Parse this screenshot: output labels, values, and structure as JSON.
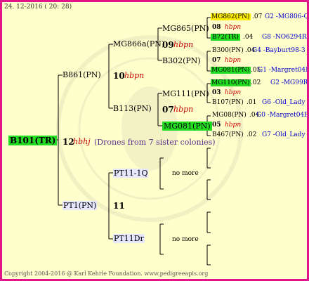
{
  "date": "24. 12-2016 ( 20: 28)",
  "root": {
    "label": "B101(TR)",
    "gen": "12",
    "hb": "hbhj",
    "note": "(Drones from 7 sister colonies)"
  },
  "dam": {
    "label": "B861(PN)",
    "gen": "10",
    "hb": "hbpn"
  },
  "sire": {
    "label": "PT1(PN)",
    "gen": "11"
  },
  "n_mg866a": {
    "label": "MG866a(PN)",
    "gen": "09",
    "hb": "hbpn"
  },
  "n_b113": {
    "label": "B113(PN)",
    "gen": "07",
    "hb": "hbpn"
  },
  "n_pt11q": {
    "label": "PT11-1Q"
  },
  "n_pt11dr": {
    "label": "PT11Dr"
  },
  "n_mg865": {
    "label": "MG865(PN)"
  },
  "n_b302": {
    "label": "B302(PN)"
  },
  "n_mg111": {
    "label": "MG111(PN)"
  },
  "n_mg081": {
    "label": "MG081(PN)"
  },
  "nomore1": "no more",
  "nomore2": "no more",
  "g1": {
    "label": "MG862(PN)",
    "gen": ".07",
    "line": "G2 -MG806-Q"
  },
  "g1b": {
    "gen": "08",
    "hb": "hbpn"
  },
  "g2": {
    "label": "B72(TR)",
    "gen": ".04",
    "line": "G8 -NO6294R"
  },
  "g3": {
    "label": "B300(PN)",
    "gen": ".04",
    "line": "G4 -Bayburt98-3"
  },
  "g3b": {
    "gen": "07",
    "hb": "hbpn"
  },
  "g4": {
    "label": "MG081(PN)",
    "gen": ".05",
    "line": "G1 -Margret04R"
  },
  "g5": {
    "label": "MG110(PN)",
    "gen": ".02",
    "line": "G2 -MG99R"
  },
  "g5b": {
    "gen": "03",
    "hb": "hbpn"
  },
  "g6": {
    "label": "B107(PN)",
    "gen": ".01",
    "line": "G6 -Old_Lady"
  },
  "g7": {
    "label": "MG08(PN)",
    "gen": ".04",
    "line": "G0 -Margret04R"
  },
  "g7b": {
    "gen": "05",
    "hb": "hbpn"
  },
  "g8": {
    "label": "B467(PN)",
    "gen": ".02",
    "line": "G7 -Old_Lady"
  },
  "footer": "Copyright 2004-2016 @ Karl Kehrle Foundation.   www.pedigreeapis.org"
}
